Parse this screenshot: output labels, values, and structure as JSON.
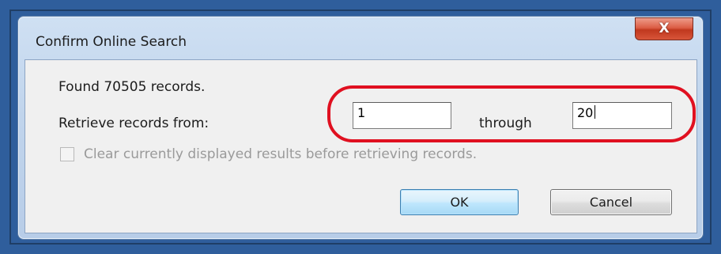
{
  "dialog": {
    "title": "Confirm Online Search",
    "close_glyph": "X"
  },
  "content": {
    "found_text": "Found 70505 records.",
    "retrieve_label": "Retrieve records from:",
    "from_value": "1",
    "through_label": "through",
    "to_value": "20",
    "clear_checkbox": {
      "label": "Clear currently displayed results before retrieving records.",
      "checked": false,
      "enabled": false
    }
  },
  "buttons": {
    "ok": "OK",
    "cancel": "Cancel"
  },
  "annotation": {
    "shape": "ellipse",
    "color": "#e01020"
  },
  "colors": {
    "desktop": "#2f5e9c",
    "close_button": "#d05035",
    "default_button_border": "#3c7fb1"
  }
}
